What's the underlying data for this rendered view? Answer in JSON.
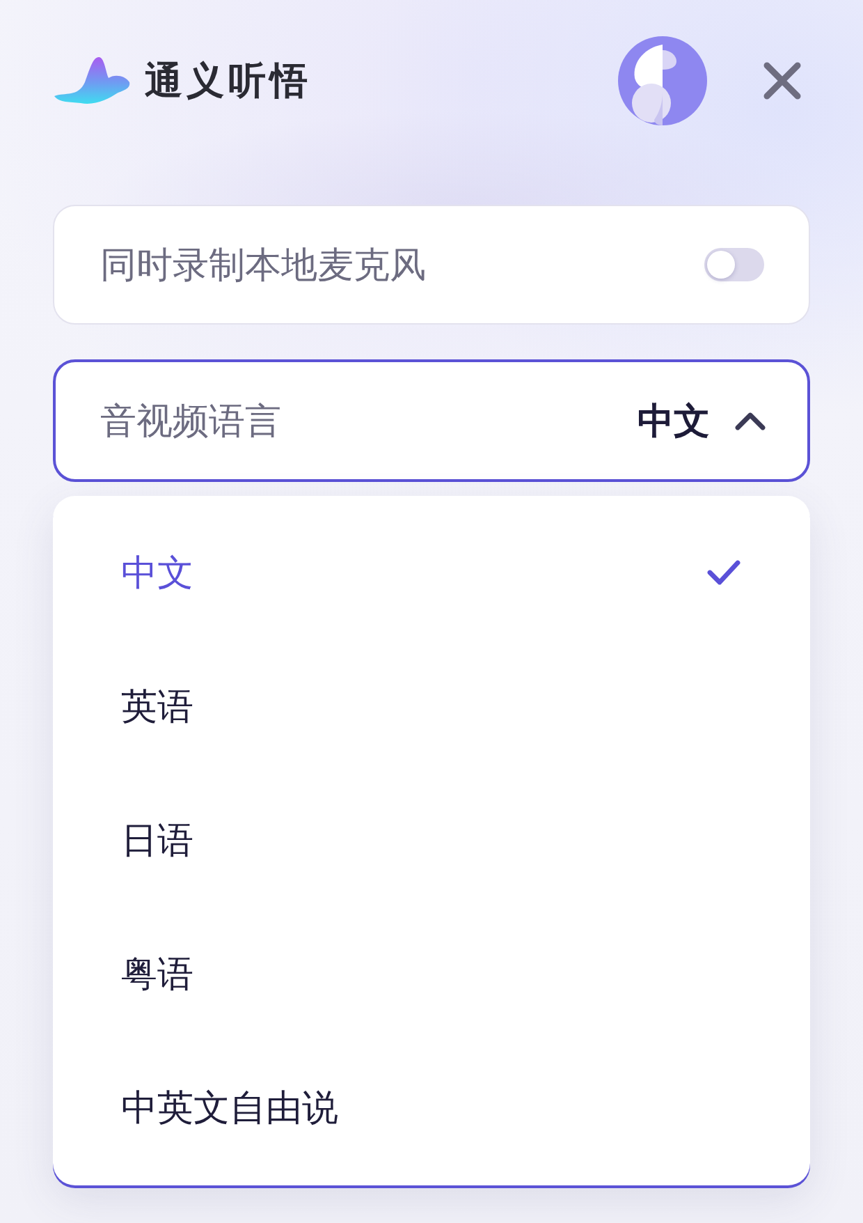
{
  "header": {
    "title": "通义听悟"
  },
  "mic_toggle": {
    "label": "同时录制本地麦克风",
    "on": false
  },
  "language_select": {
    "label": "音视频语言",
    "value": "中文",
    "expanded": true
  },
  "language_options": [
    {
      "label": "中文",
      "selected": true
    },
    {
      "label": "英语",
      "selected": false
    },
    {
      "label": "日语",
      "selected": false
    },
    {
      "label": "粤语",
      "selected": false
    },
    {
      "label": "中英文自由说",
      "selected": false
    }
  ]
}
